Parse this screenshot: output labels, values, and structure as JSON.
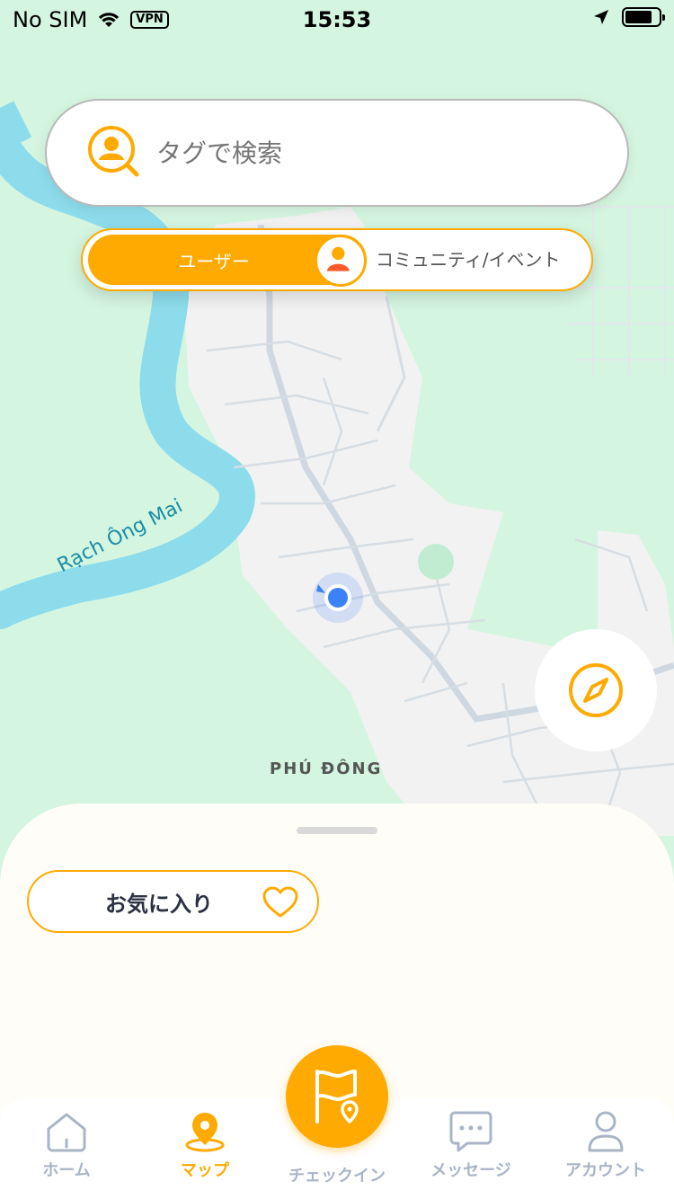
{
  "status_bar": {
    "carrier": "No SIM",
    "vpn": "VPN",
    "time": "15:53",
    "icons": [
      "wifi-icon",
      "location-arrow-icon",
      "battery-icon"
    ]
  },
  "search": {
    "placeholder": "タグで検索",
    "icon": "user-search-icon"
  },
  "toggle": {
    "active_label": "ユーザー",
    "other_label": "コミュニティ/イベント",
    "accent": "#ffaa00"
  },
  "map": {
    "river_label": "Rạch Ông Mai",
    "place_label": "PHÚ ĐÔNG",
    "colors": {
      "land": "#d4f5e0",
      "urban": "#f2f2f2",
      "water": "#8ddcec",
      "road": "#cfd8e0",
      "location_dot": "#3b82f6"
    }
  },
  "sheet": {
    "favorites_label": "お気に入り"
  },
  "tabbar": {
    "tabs": [
      {
        "label": "ホーム",
        "icon": "home-icon",
        "active": false
      },
      {
        "label": "マップ",
        "icon": "map-pin-icon",
        "active": true
      },
      {
        "label": "チェックイン",
        "icon": "flag-pin-icon",
        "active": false
      },
      {
        "label": "メッセージ",
        "icon": "chat-icon",
        "active": false
      },
      {
        "label": "アカウント",
        "icon": "account-icon",
        "active": false
      }
    ],
    "active_color": "#ffaa00",
    "inactive_color": "#a9b4c7"
  }
}
